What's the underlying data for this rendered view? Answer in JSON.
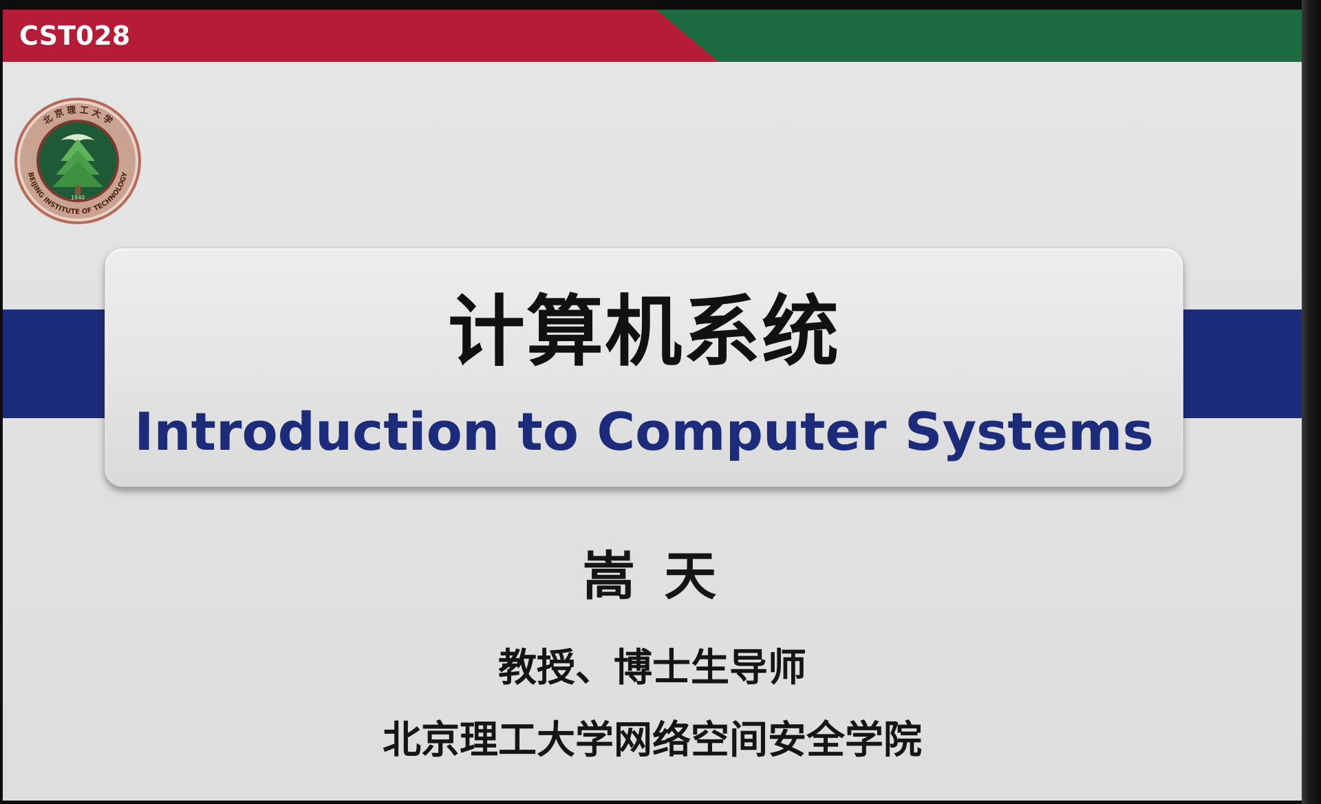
{
  "slide": {
    "course_code": "CST028",
    "logo_icon": "bit-university-seal-icon",
    "logo_text": "北京理工大学 BEIJING INSTITUTE OF TECHNOLOGY 1940",
    "title_cn": "计算机系统",
    "title_en": "Introduction to Computer Systems",
    "author": "嵩 天",
    "author_title": "教授、博士生导师",
    "affiliation": "北京理工大学网络空间安全学院"
  },
  "colors": {
    "red": "#b71c37",
    "green": "#1d6b40",
    "blue": "#1d2c7a",
    "background": "#e4e4e4"
  }
}
